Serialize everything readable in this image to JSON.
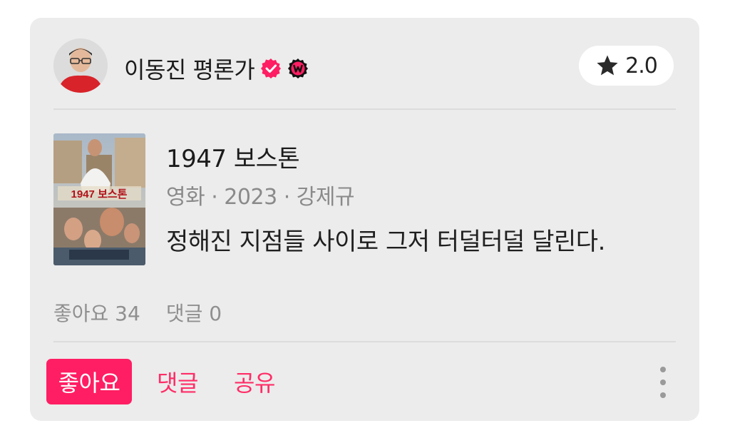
{
  "header": {
    "author_name": "이동진 평론가",
    "avatar_icon": "person-avatar-icon",
    "badges": [
      "verified-check-icon",
      "watcha-w-badge-icon"
    ],
    "rating_icon": "star-icon",
    "rating_value": "2.0"
  },
  "content": {
    "poster_icon": "movie-poster-image",
    "title": "1947 보스톤",
    "meta": "영화 · 2023 · 강제규",
    "comment": "정해진 지점들 사이로 그저 터덜터덜 달린다."
  },
  "stats": {
    "likes": "좋아요 34",
    "comments": "댓글 0"
  },
  "actions": {
    "like": "좋아요",
    "comment": "댓글",
    "share": "공유",
    "more_icon": "more-vertical-icon"
  },
  "colors": {
    "accent": "#ff1e63",
    "card_bg": "#ececec",
    "muted_text": "#8a8a8a"
  }
}
